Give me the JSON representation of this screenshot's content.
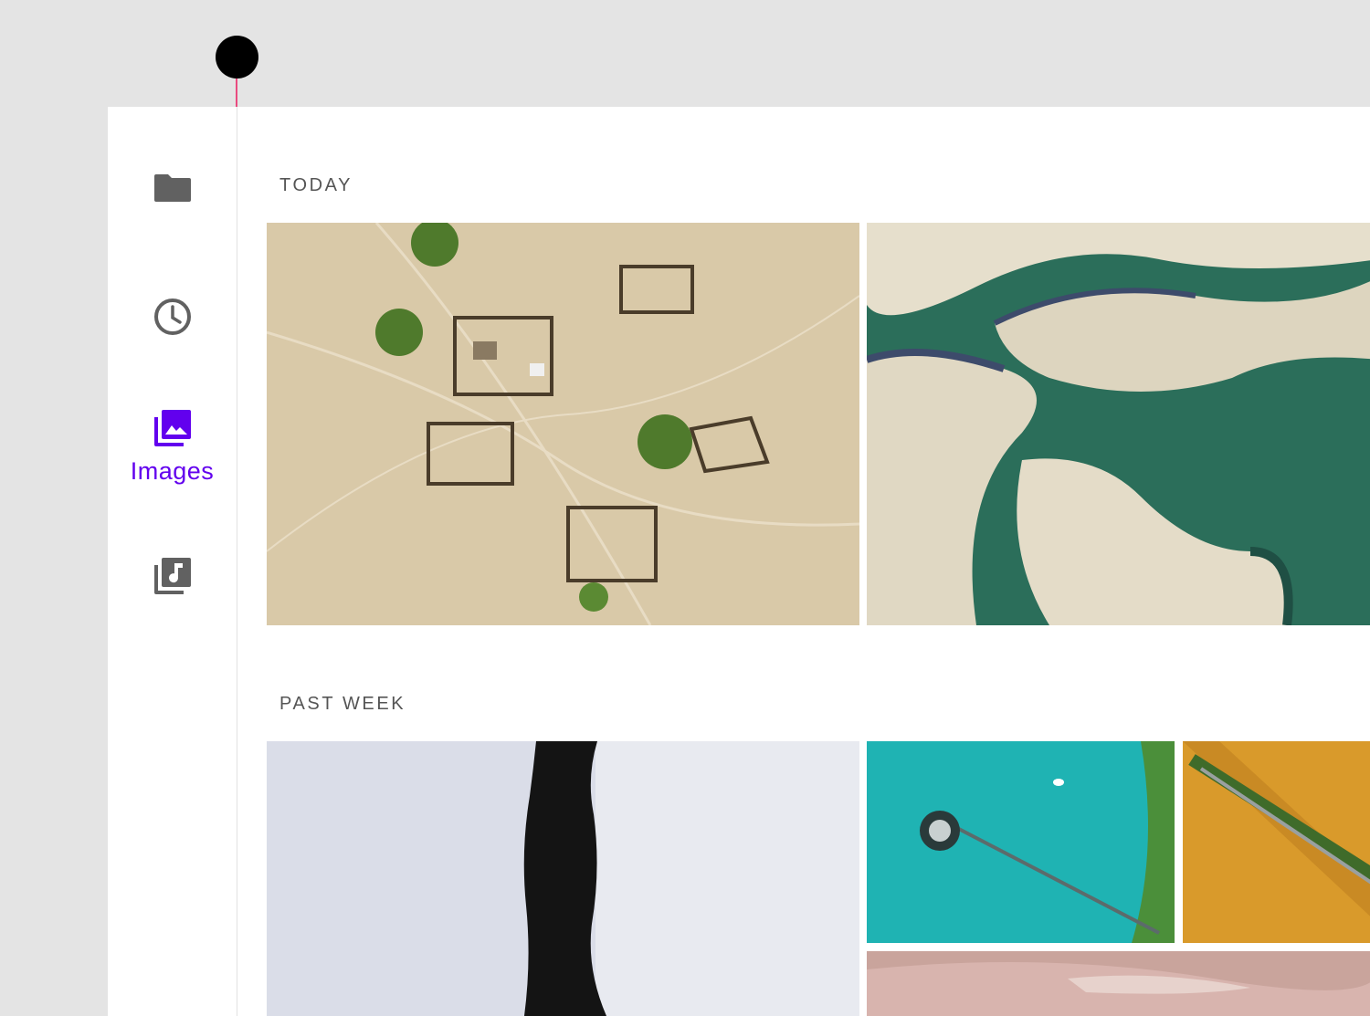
{
  "nav": {
    "items": [
      {
        "icon": "folder-icon",
        "label": ""
      },
      {
        "icon": "clock-icon",
        "label": ""
      },
      {
        "icon": "image-gallery-icon",
        "label": "Images",
        "active": true
      },
      {
        "icon": "music-library-icon",
        "label": ""
      }
    ],
    "active_color": "#6200ee",
    "icon_color": "#616161"
  },
  "sections": {
    "today": {
      "title": "TODAY"
    },
    "past_week": {
      "title": "PAST WEEK"
    }
  },
  "colors": {
    "background": "#e4e4e4",
    "surface": "#ffffff",
    "marker": "#000000",
    "marker_line": "#e94a7f"
  }
}
